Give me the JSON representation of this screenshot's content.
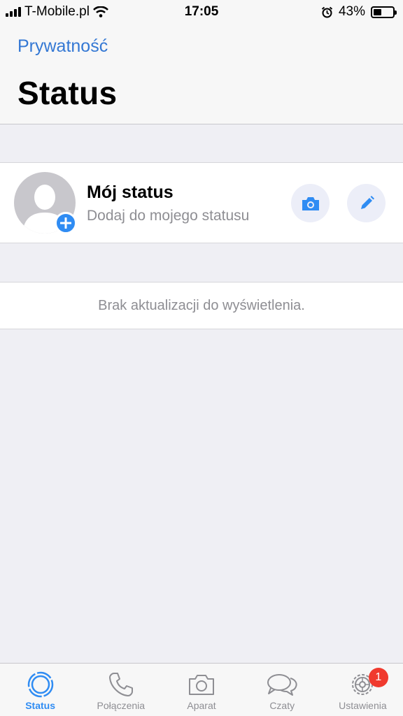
{
  "status_bar": {
    "carrier": "T-Mobile.pl",
    "time": "17:05",
    "battery": "43%",
    "battery_level": 0.43
  },
  "nav": {
    "back_label": "Prywatność",
    "title": "Status"
  },
  "my_status": {
    "title": "Mój status",
    "subtitle": "Dodaj do mojego statusu"
  },
  "empty_message": "Brak aktualizacji do wyświetlenia.",
  "tabs": [
    {
      "label": "Status",
      "icon": "status-icon",
      "active": true
    },
    {
      "label": "Połączenia",
      "icon": "phone-icon",
      "active": false
    },
    {
      "label": "Aparat",
      "icon": "camera-icon",
      "active": false
    },
    {
      "label": "Czaty",
      "icon": "chat-bubbles-icon",
      "active": false
    },
    {
      "label": "Ustawienia",
      "icon": "gear-icon",
      "active": false,
      "badge": "1"
    }
  ],
  "colors": {
    "accent": "#2f8cf3",
    "link": "#3478d4",
    "badge": "#f03a2e",
    "background": "#efeff4"
  }
}
